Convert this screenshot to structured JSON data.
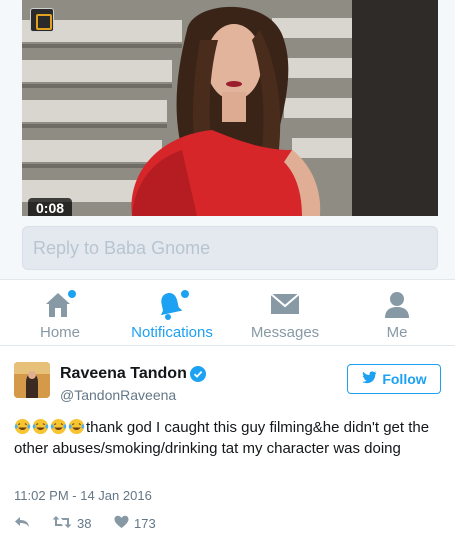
{
  "video": {
    "duration": "0:08"
  },
  "reply": {
    "placeholder": "Reply to Baba Gnome"
  },
  "tabs": [
    {
      "label": "Home",
      "icon": "home-icon",
      "active": false,
      "unread_dot": true
    },
    {
      "label": "Notifications",
      "icon": "bell-icon",
      "active": true,
      "unread_dot": true
    },
    {
      "label": "Messages",
      "icon": "envelope-icon",
      "active": false,
      "unread_dot": false
    },
    {
      "label": "Me",
      "icon": "person-icon",
      "active": false,
      "unread_dot": false
    }
  ],
  "tweet": {
    "display_name": "Raveena Tandon",
    "verified": true,
    "handle": "@TandonRaveena",
    "follow_label": "Follow",
    "emoji_count": 4,
    "text": "thank god I caught this guy filming&he didn't get the other abuses/smoking/drinking tat my character was doing",
    "timestamp": "11:02 PM - 14 Jan 2016",
    "retweets": "38",
    "likes": "173"
  },
  "colors": {
    "accent": "#1da1f2",
    "muted": "#8899a6",
    "text": "#14171a"
  }
}
